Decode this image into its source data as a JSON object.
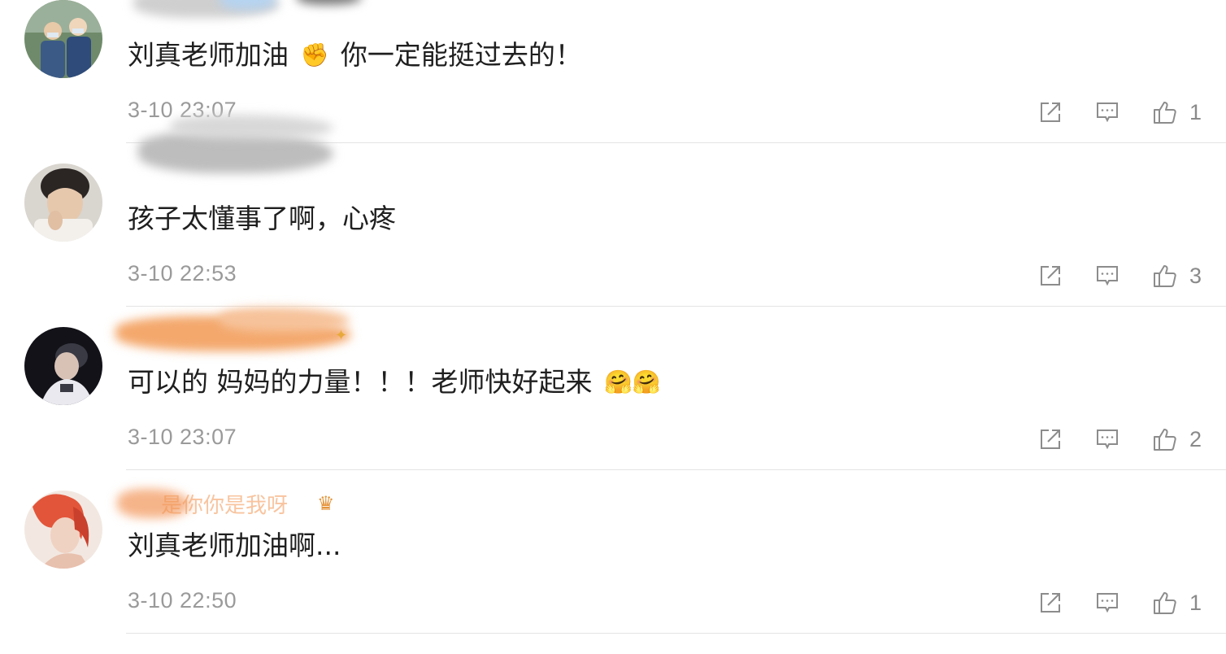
{
  "comments": [
    {
      "text": "刘真老师加油",
      "emoji": "✊",
      "text_after": "你一定能挺过去的！",
      "time": "3-10 23:07",
      "likes": "1",
      "avatar_icon": "avatar-children-photo"
    },
    {
      "text": "孩子太懂事了啊，心疼",
      "emoji": "",
      "text_after": "",
      "time": "3-10 22:53",
      "likes": "3",
      "avatar_icon": "avatar-young-man-photo"
    },
    {
      "text": "可以的 妈妈的力量！！！老师快好起来",
      "emoji": "🤗🤗",
      "text_after": "",
      "time": "3-10 23:07",
      "likes": "2",
      "avatar_icon": "avatar-woman-cap-photo"
    },
    {
      "text": "刘真老师加油啊...",
      "emoji": "",
      "text_after": "",
      "time": "3-10 22:50",
      "likes": "1",
      "avatar_icon": "avatar-red-hair-illustration",
      "username": "是你你是我呀"
    }
  ],
  "colors": {
    "text": "#1f1f1f",
    "meta": "#9a9a9a",
    "icon": "#8c8c8c",
    "divider": "#e4e4e4",
    "vip_name": "#f29450"
  },
  "icons": [
    "share-icon",
    "comment-icon",
    "like-icon"
  ]
}
